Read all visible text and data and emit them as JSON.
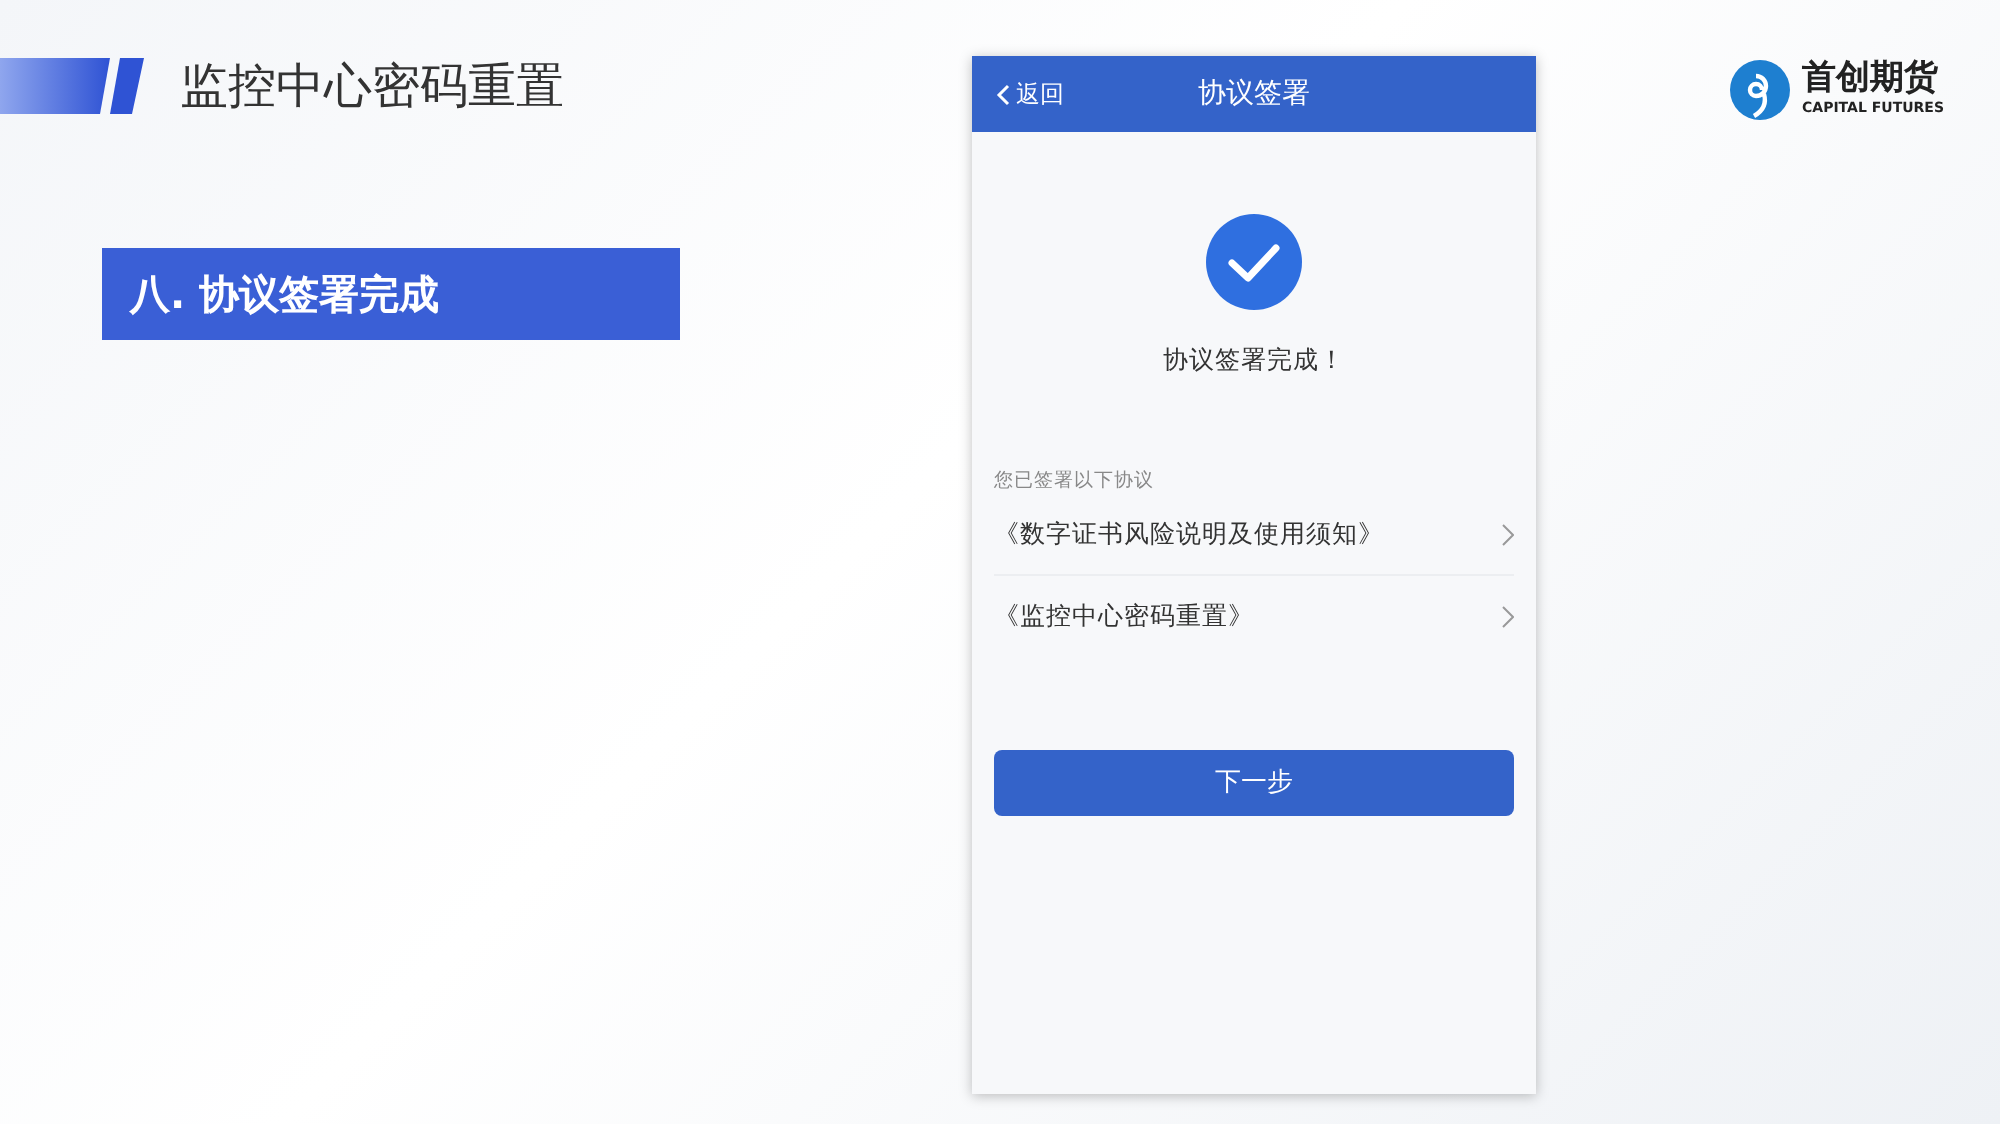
{
  "slide_title": "监控中心密码重置",
  "section_label": "八. 协议签署完成",
  "logo": {
    "name": "首创期货",
    "subtitle": "CAPITAL FUTURES"
  },
  "phone": {
    "nav": {
      "back": "返回",
      "title": "协议签署"
    },
    "status_text": "协议签署完成！",
    "list_heading": "您已签署以下协议",
    "agreements": [
      {
        "title": "《数字证书风险说明及使用须知》"
      },
      {
        "title": "《监控中心密码重置》"
      }
    ],
    "next_button": "下一步"
  }
}
